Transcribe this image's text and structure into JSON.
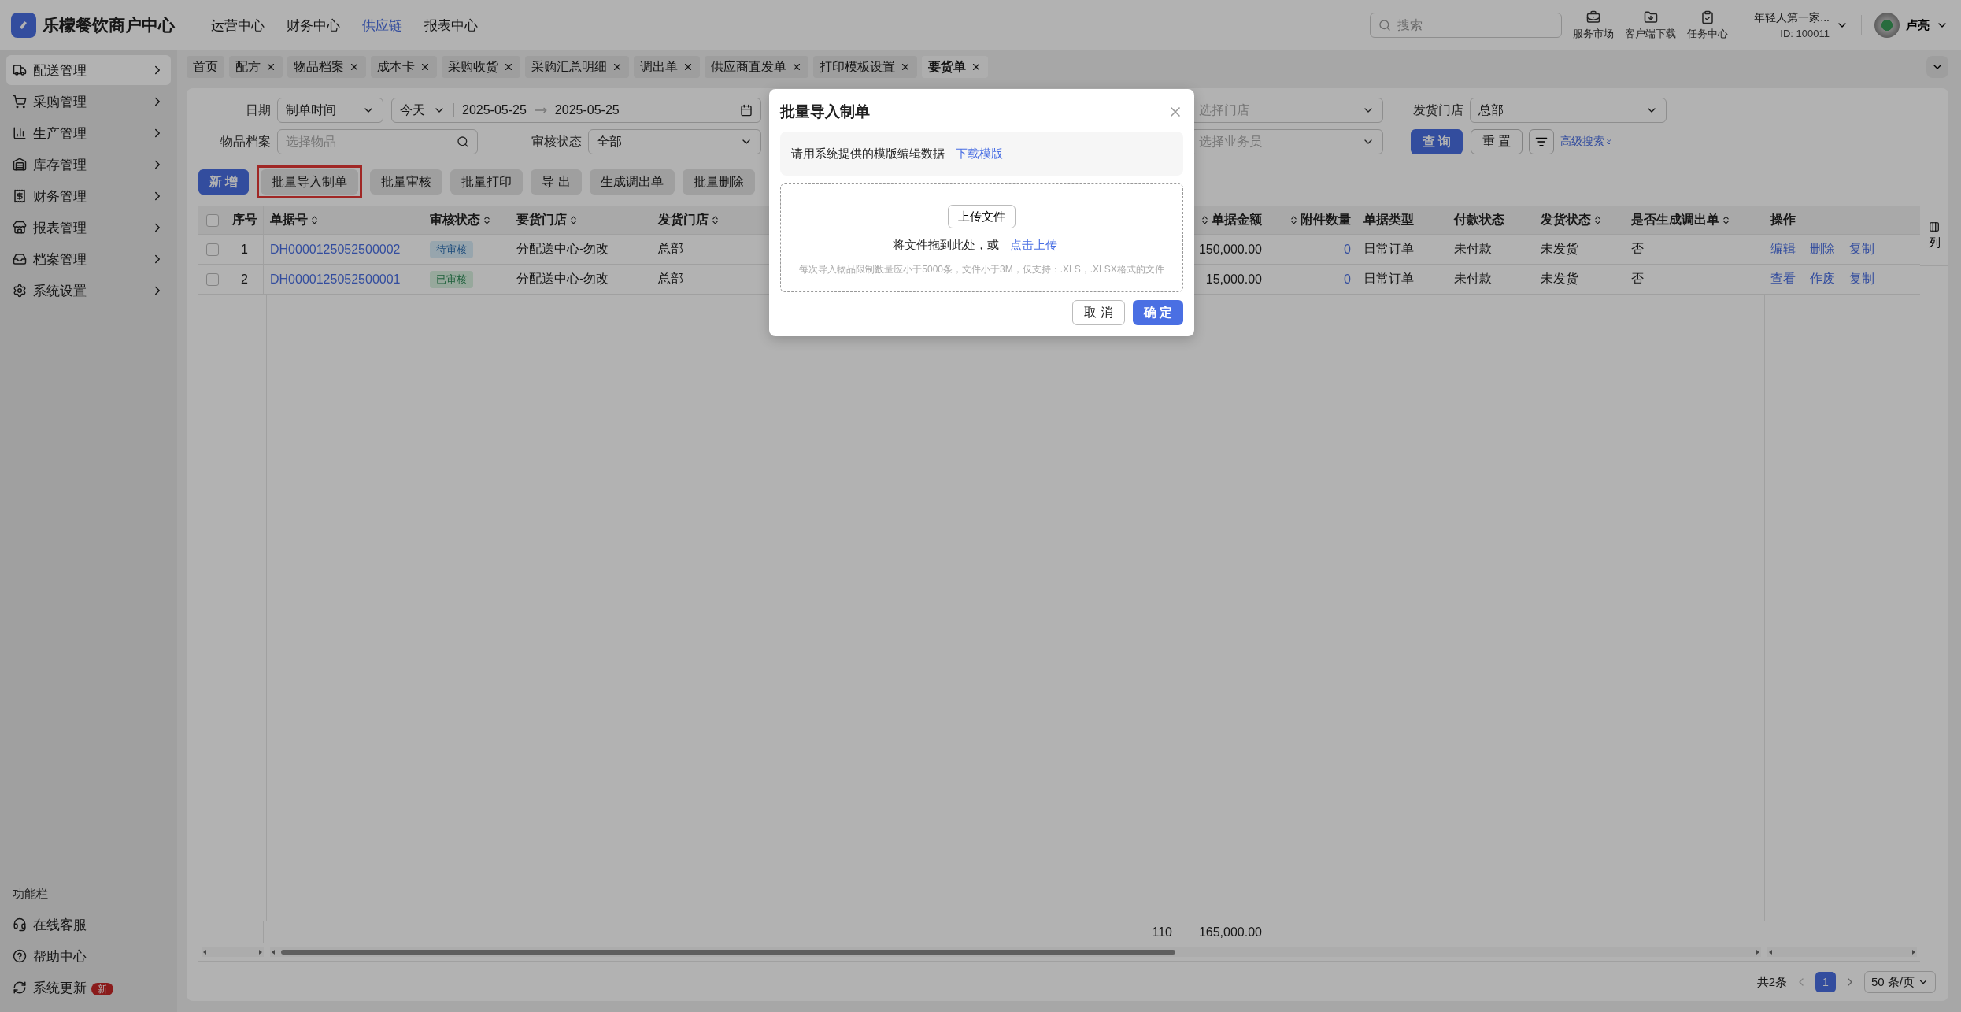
{
  "app": {
    "name": "乐檬餐饮商户中心"
  },
  "top_nav": [
    {
      "label": "运营中心",
      "selected": false
    },
    {
      "label": "财务中心",
      "selected": false
    },
    {
      "label": "供应链",
      "selected": true
    },
    {
      "label": "报表中心",
      "selected": false
    }
  ],
  "search": {
    "placeholder": "搜索"
  },
  "shortcuts": [
    {
      "label": "服务市场",
      "kind": "market"
    },
    {
      "label": "客户端下载",
      "kind": "download"
    },
    {
      "label": "任务中心",
      "kind": "tasks"
    }
  ],
  "account": {
    "name": "年轻人第一家...",
    "id": "ID: 100011"
  },
  "user": {
    "name": "卢亮"
  },
  "sidebar": {
    "items": [
      {
        "label": "配送管理",
        "kind": "truck",
        "selected": true
      },
      {
        "label": "采购管理",
        "kind": "cart",
        "selected": false
      },
      {
        "label": "生产管理",
        "kind": "chart",
        "selected": false
      },
      {
        "label": "库存管理",
        "kind": "warehouse",
        "selected": false
      },
      {
        "label": "财务管理",
        "kind": "receipt",
        "selected": false
      },
      {
        "label": "报表管理",
        "kind": "store",
        "selected": false
      },
      {
        "label": "档案管理",
        "kind": "inbox",
        "selected": false
      },
      {
        "label": "系统设置",
        "kind": "settings",
        "selected": false
      }
    ],
    "footer_title": "功能栏",
    "footer_items": [
      {
        "label": "在线客服",
        "kind": "support"
      },
      {
        "label": "帮助中心",
        "kind": "help"
      },
      {
        "label": "系统更新",
        "kind": "update",
        "badge": "新"
      }
    ]
  },
  "tabs": [
    {
      "label": "首页",
      "closable": false,
      "selected": false
    },
    {
      "label": "配方",
      "closable": true,
      "selected": false
    },
    {
      "label": "物品档案",
      "closable": true,
      "selected": false
    },
    {
      "label": "成本卡",
      "closable": true,
      "selected": false
    },
    {
      "label": "采购收货",
      "closable": true,
      "selected": false
    },
    {
      "label": "采购汇总明细",
      "closable": true,
      "selected": false
    },
    {
      "label": "调出单",
      "closable": true,
      "selected": false
    },
    {
      "label": "供应商直发单",
      "closable": true,
      "selected": false
    },
    {
      "label": "打印模板设置",
      "closable": true,
      "selected": false
    },
    {
      "label": "要货单",
      "closable": true,
      "selected": true
    }
  ],
  "filters": {
    "date_label": "日期",
    "date_type": "制单时间",
    "date_range": "今天",
    "date_start": "2025-05-25",
    "date_end": "2025-05-25",
    "item_label": "物品档案",
    "item_placeholder": "选择物品",
    "audit_label": "审核状态",
    "audit_value": "全部",
    "store_placeholder": "选择门店",
    "staff_placeholder": "选择业务员",
    "ship_store_label": "发货门店",
    "ship_store_value": "总部",
    "query": "查 询",
    "reset": "重 置",
    "advanced": "高级搜索"
  },
  "toolbar": [
    {
      "label": "新 增",
      "kind": "primary",
      "highlighted": false
    },
    {
      "label": "批量导入制单",
      "kind": "default",
      "highlighted": true
    },
    {
      "label": "批量审核",
      "kind": "default",
      "highlighted": false
    },
    {
      "label": "批量打印",
      "kind": "default",
      "highlighted": false
    },
    {
      "label": "导 出",
      "kind": "default",
      "highlighted": false
    },
    {
      "label": "生成调出单",
      "kind": "default",
      "highlighted": false
    },
    {
      "label": "批量删除",
      "kind": "default",
      "highlighted": false
    }
  ],
  "table": {
    "columns": [
      {
        "label": "序号",
        "kind": "index",
        "sortable": false
      },
      {
        "label": "单据号",
        "kind": "link",
        "sortable": true
      },
      {
        "label": "审核状态",
        "kind": "tag",
        "sortable": true
      },
      {
        "label": "要货门店",
        "kind": "text",
        "sortable": true
      },
      {
        "label": "发货门店",
        "kind": "text",
        "sortable": true
      },
      {
        "label": "单据金额",
        "kind": "amount",
        "sortable": true
      },
      {
        "label": "附件数量",
        "kind": "count",
        "sortable": true
      },
      {
        "label": "单据类型",
        "kind": "text",
        "sortable": false
      },
      {
        "label": "付款状态",
        "kind": "text",
        "sortable": false
      },
      {
        "label": "发货状态",
        "kind": "text",
        "sortable": true
      },
      {
        "label": "是否生成调出单",
        "kind": "text",
        "sortable": true
      },
      {
        "label": "操作",
        "kind": "actions",
        "sortable": false
      }
    ],
    "rows": [
      {
        "selected": false,
        "cells": [
          "1",
          "DH0000125052500002",
          {
            "label": "待审核",
            "kind": "pending"
          },
          "分配送中心-勿改",
          "总部",
          "150,000.00",
          "0",
          "日常订单",
          "未付款",
          "未发货",
          "否",
          [
            "编辑",
            "删除",
            "复制"
          ]
        ]
      },
      {
        "selected": false,
        "cells": [
          "2",
          "DH0000125052500001",
          {
            "label": "已审核",
            "kind": "approved"
          },
          "分配送中心-勿改",
          "总部",
          "15,000.00",
          "0",
          "日常订单",
          "未付款",
          "未发货",
          "否",
          [
            "查看",
            "作废",
            "复制"
          ]
        ]
      }
    ],
    "all_selected": false,
    "summary": {
      "column_7": "110",
      "amount": "165,000.00"
    },
    "column_settings": "列"
  },
  "pagination": {
    "total": "共2条",
    "pages": [
      {
        "label": "1",
        "selected": true
      }
    ],
    "page_size": "50 条/页"
  },
  "dialog": {
    "title": "批量导入制单",
    "hint": "请用系统提供的模版编辑数据",
    "download_link": "下载模版",
    "upload_button": "上传文件",
    "drop_text": "将文件拖到此处，或",
    "upload_link": "点击上传",
    "note": "每次导入物品限制数量应小于5000条，文件小于3M，仅支持：.XLS，.XLSX格式的文件",
    "cancel": "取 消",
    "confirm": "确 定"
  }
}
